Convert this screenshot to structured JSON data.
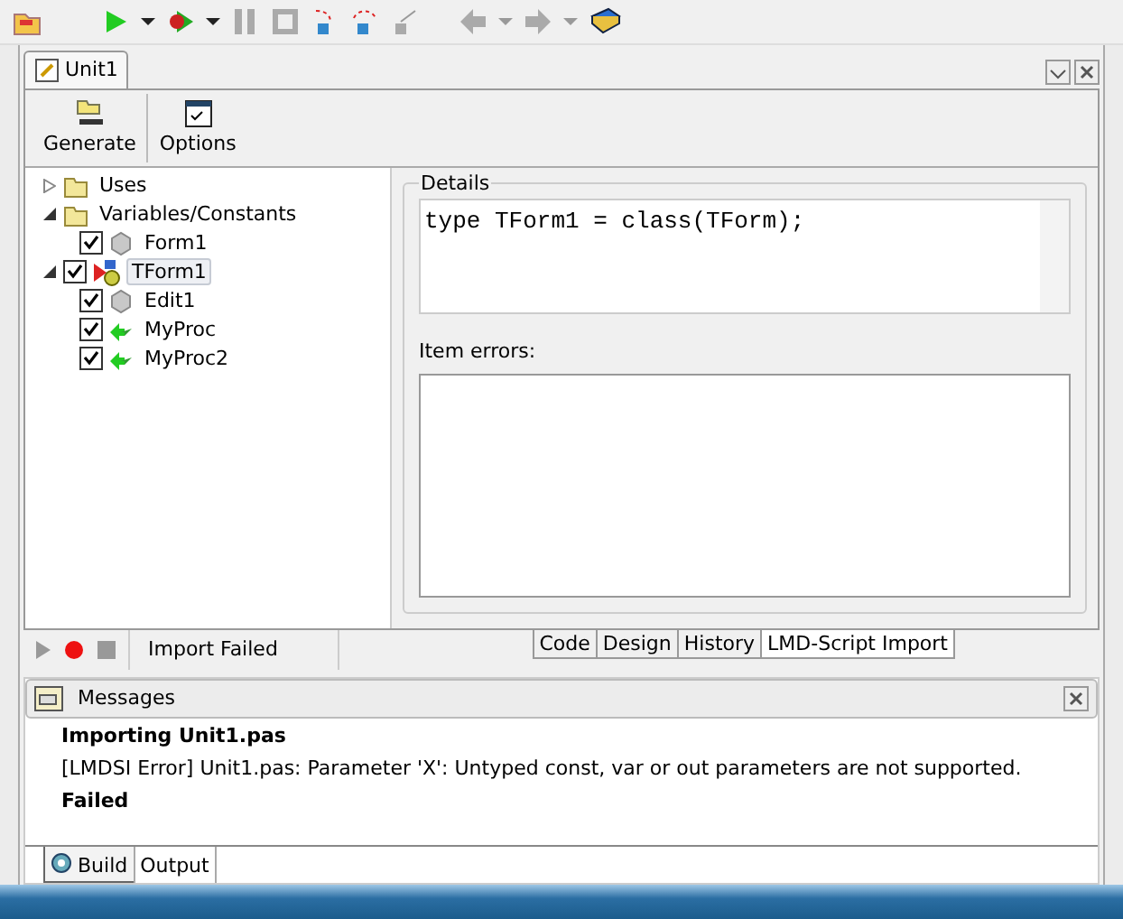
{
  "document_tab": {
    "title": "Unit1"
  },
  "toolbar": [
    {
      "label": "Generate",
      "kind": "generate"
    },
    {
      "label": "Options",
      "kind": "options"
    }
  ],
  "tree": [
    {
      "label": "Uses",
      "kind": "folder",
      "expanded": false
    },
    {
      "label": "Variables/Constants",
      "kind": "folder",
      "expanded": true,
      "children": [
        {
          "label": "Form1",
          "kind": "component",
          "checked": true
        }
      ]
    },
    {
      "label": "TForm1",
      "kind": "class",
      "expanded": true,
      "checked": true,
      "selected": true,
      "children": [
        {
          "label": "Edit1",
          "kind": "component",
          "checked": true
        },
        {
          "label": "MyProc",
          "kind": "procedure",
          "checked": true
        },
        {
          "label": "MyProc2",
          "kind": "procedure",
          "checked": true
        }
      ]
    }
  ],
  "details": {
    "title": "Details",
    "code": "type TForm1 = class(TForm);",
    "errors_label": "Item errors:"
  },
  "status": {
    "text": "Import Failed"
  },
  "view_tabs": [
    {
      "label": "Code",
      "selected": false
    },
    {
      "label": "Design",
      "selected": false
    },
    {
      "label": "History",
      "selected": false
    },
    {
      "label": "LMD-Script Import",
      "selected": true
    }
  ],
  "messages": {
    "title": "Messages",
    "lines": [
      {
        "text": "Importing Unit1.pas",
        "kind": "heading"
      },
      {
        "text": "[LMDSI Error] Unit1.pas: Parameter 'X': Untyped const, var or out parameters are not supported.",
        "kind": "error"
      },
      {
        "text": "Failed",
        "kind": "heading"
      }
    ],
    "tabs": [
      {
        "label": "Build",
        "selected": true,
        "kind": "build"
      },
      {
        "label": "Output",
        "selected": false,
        "kind": "output"
      }
    ]
  }
}
